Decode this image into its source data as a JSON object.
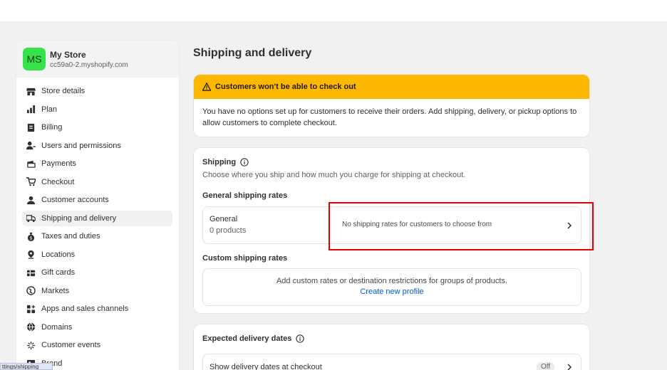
{
  "store": {
    "initials": "MS",
    "name": "My Store",
    "domain": "cc59a0-2.myshopify.com"
  },
  "nav": [
    {
      "label": "Store details",
      "icon": "store-icon"
    },
    {
      "label": "Plan",
      "icon": "plan-icon"
    },
    {
      "label": "Billing",
      "icon": "billing-icon"
    },
    {
      "label": "Users and permissions",
      "icon": "users-icon"
    },
    {
      "label": "Payments",
      "icon": "payments-icon"
    },
    {
      "label": "Checkout",
      "icon": "cart-icon"
    },
    {
      "label": "Customer accounts",
      "icon": "person-icon"
    },
    {
      "label": "Shipping and delivery",
      "icon": "truck-icon"
    },
    {
      "label": "Taxes and duties",
      "icon": "taxes-icon"
    },
    {
      "label": "Locations",
      "icon": "location-icon"
    },
    {
      "label": "Gift cards",
      "icon": "gift-card-icon"
    },
    {
      "label": "Markets",
      "icon": "globe-icon"
    },
    {
      "label": "Apps and sales channels",
      "icon": "apps-icon"
    },
    {
      "label": "Domains",
      "icon": "domains-globe-icon"
    },
    {
      "label": "Customer events",
      "icon": "sparkle-icon"
    },
    {
      "label": "Brand",
      "icon": "brand-icon"
    }
  ],
  "page": {
    "title": "Shipping and delivery"
  },
  "banner": {
    "title": "Customers won't be able to check out",
    "body": "You have no options set up for customers to receive their orders. Add shipping, delivery, or pickup options to allow customers to complete checkout."
  },
  "shipping": {
    "title": "Shipping",
    "description": "Choose where you ship and how much you charge for shipping at checkout.",
    "general_rates_title": "General shipping rates",
    "general_profile_name": "General",
    "general_profile_products": "0 products",
    "no_rates_text": "No shipping rates for customers to choose from",
    "custom_rates_title": "Custom shipping rates",
    "custom_rates_text": "Add custom rates or destination restrictions for groups of products.",
    "create_profile_link": "Create new profile"
  },
  "delivery_dates": {
    "title": "Expected delivery dates",
    "row_label": "Show delivery dates at checkout",
    "status": "Off"
  },
  "status_bar": {
    "url": "ttings/shipping"
  },
  "colors": {
    "banner": "#ffb800",
    "avatar": "#36e24a",
    "link": "#005bd3",
    "highlight": "#e00000"
  }
}
